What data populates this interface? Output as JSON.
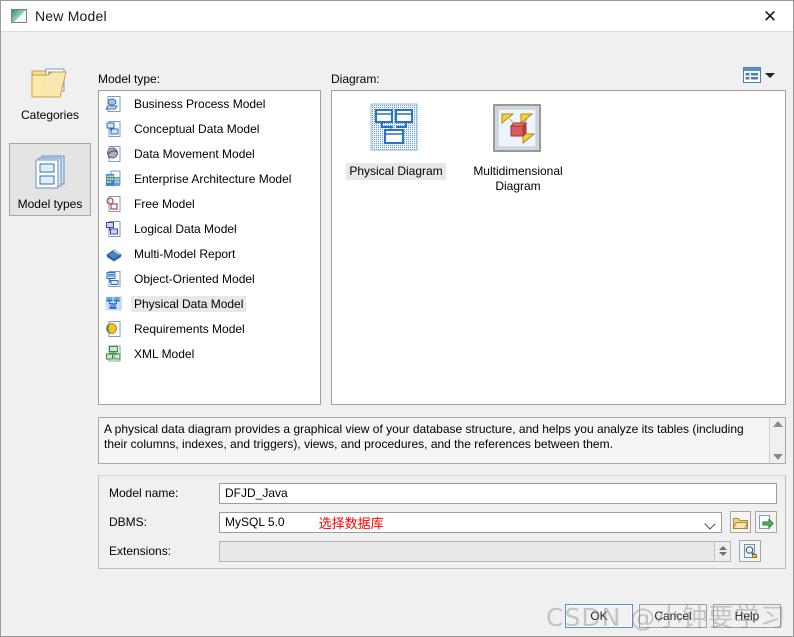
{
  "window": {
    "title": "New Model",
    "app_icon": "model-window-icon",
    "close_label": "✕"
  },
  "rail": {
    "items": [
      {
        "label": "Categories",
        "icon": "folder-documents-icon",
        "selected": false
      },
      {
        "label": "Model types",
        "icon": "stacked-documents-icon",
        "selected": true
      }
    ]
  },
  "labels": {
    "model_type": "Model type:",
    "diagram": "Diagram:"
  },
  "model_types": {
    "items": [
      {
        "label": "Business Process Model",
        "icon": "business-process-icon",
        "selected": false
      },
      {
        "label": "Conceptual Data Model",
        "icon": "conceptual-data-icon",
        "selected": false
      },
      {
        "label": "Data Movement Model",
        "icon": "data-movement-icon",
        "selected": false
      },
      {
        "label": "Enterprise Architecture Model",
        "icon": "enterprise-architecture-icon",
        "selected": false
      },
      {
        "label": "Free Model",
        "icon": "free-model-icon",
        "selected": false
      },
      {
        "label": "Logical Data Model",
        "icon": "logical-data-icon",
        "selected": false
      },
      {
        "label": "Multi-Model Report",
        "icon": "multi-model-report-icon",
        "selected": false
      },
      {
        "label": "Object-Oriented Model",
        "icon": "object-oriented-icon",
        "selected": false
      },
      {
        "label": "Physical Data Model",
        "icon": "physical-data-icon",
        "selected": true
      },
      {
        "label": "Requirements Model",
        "icon": "requirements-icon",
        "selected": false
      },
      {
        "label": "XML Model",
        "icon": "xml-model-icon",
        "selected": false
      }
    ]
  },
  "diagrams": {
    "items": [
      {
        "label": "Physical Diagram",
        "icon": "physical-diagram-icon",
        "selected": true
      },
      {
        "label": "Multidimensional Diagram",
        "icon": "multidimensional-diagram-icon",
        "selected": false
      }
    ],
    "view_toggle_icon": "list-view-icon"
  },
  "description": {
    "text": "A physical data diagram provides a graphical view of your database structure, and helps you analyze its tables (including their columns, indexes, and triggers), views, and procedures, and the references between them."
  },
  "form": {
    "model_name_label": "Model name:",
    "model_name_value": "DFJD_Java",
    "dbms_label": "DBMS:",
    "dbms_value": "MySQL 5.0",
    "dbms_annotation": "选择数据库",
    "extensions_label": "Extensions:",
    "extensions_value": "",
    "browse_icon": "folder-open-icon",
    "import_icon": "import-arrow-icon",
    "preview_icon": "magnifier-page-icon"
  },
  "buttons": {
    "ok": "OK",
    "cancel": "Cancel",
    "help": "Help"
  },
  "watermark": {
    "text": "CSDN @小钟要学习"
  },
  "colors": {
    "accent_blue": "#2a6fd4",
    "annotation_red": "#ff0000",
    "window_bg": "#f0f0f0",
    "panel_bg": "#ffffff"
  }
}
